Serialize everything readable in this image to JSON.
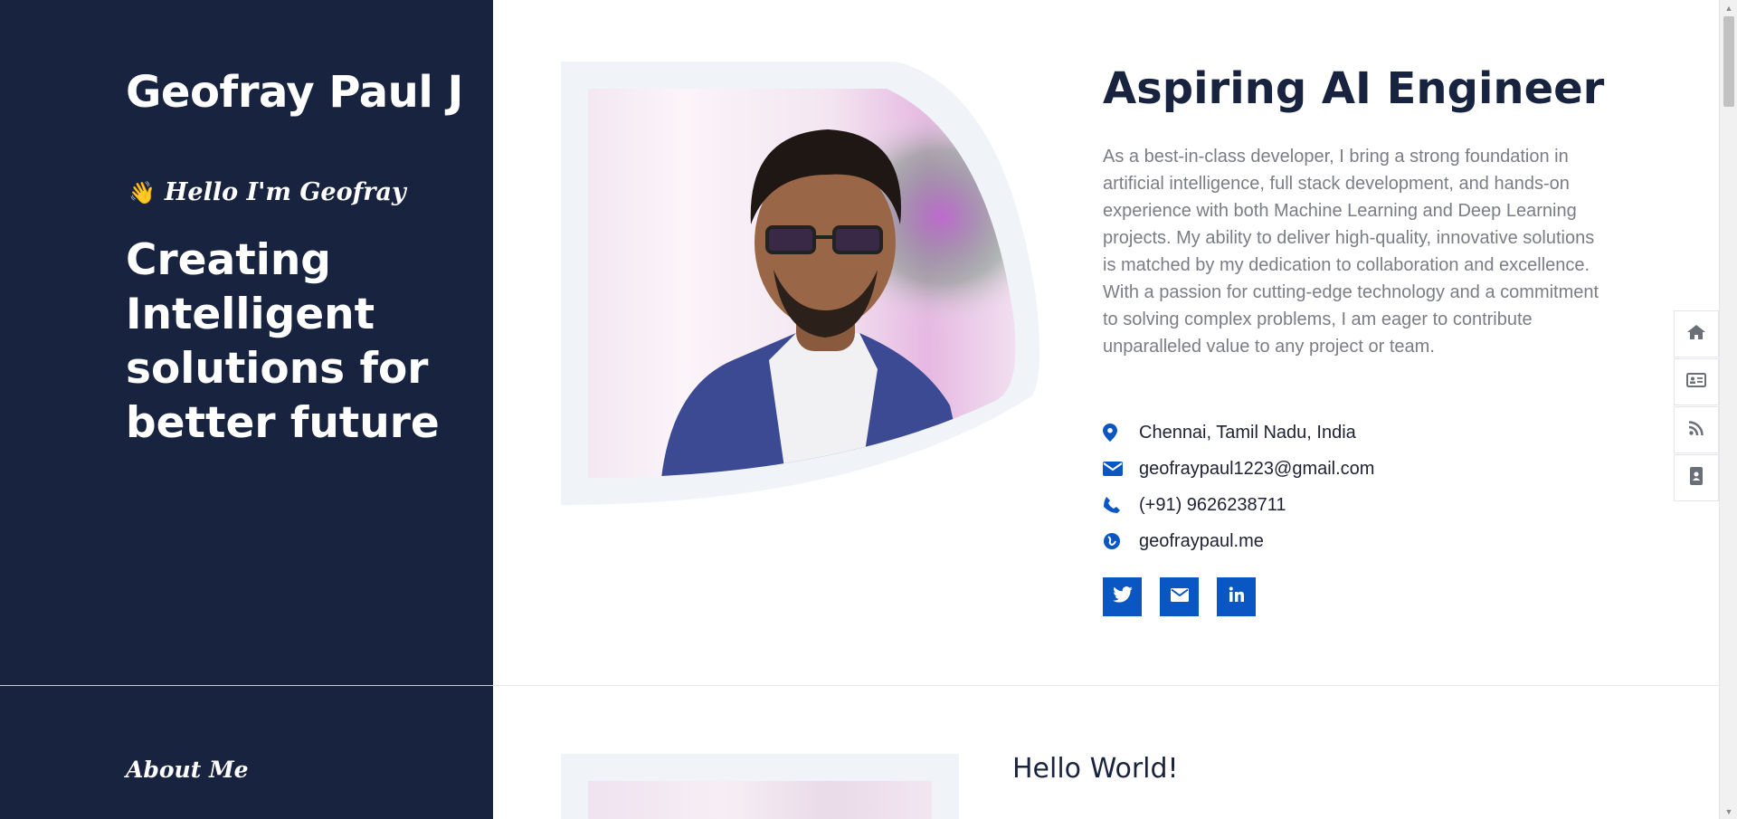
{
  "sidebar": {
    "name": "Geofray Paul J",
    "greeting_emoji": "👋",
    "greeting": "Hello I'm Geofray",
    "tagline": "Creating Intelligent solutions for better future",
    "about_heading": "About Me"
  },
  "hero": {
    "title": "Aspiring AI Engineer",
    "bio": "As a best-in-class developer, I bring a strong foundation in artificial intelligence, full stack development, and hands-on experience with both Machine Learning and Deep Learning projects. My ability to deliver high-quality, innovative solutions is matched by my dedication to collaboration and excellence. With a passion for cutting-edge technology and a commitment to solving complex problems, I am eager to contribute unparalleled value to any project or team."
  },
  "contacts": [
    {
      "icon": "map-marker-icon",
      "text": "Chennai, Tamil Nadu, India"
    },
    {
      "icon": "envelope-icon",
      "text": "geofraypaul1223@gmail.com"
    },
    {
      "icon": "phone-icon",
      "text": "(+91) 9626238711"
    },
    {
      "icon": "globe-icon",
      "text": "geofraypaul.me"
    }
  ],
  "socials": [
    {
      "icon": "twitter-icon"
    },
    {
      "icon": "envelope-icon"
    },
    {
      "icon": "linkedin-icon"
    }
  ],
  "side_nav": [
    {
      "icon": "home-icon"
    },
    {
      "icon": "id-card-icon"
    },
    {
      "icon": "rss-icon"
    },
    {
      "icon": "contact-book-icon"
    }
  ],
  "next_section": {
    "heading": "Hello World!"
  },
  "colors": {
    "sidebar_bg": "#18233f",
    "accent": "#0a56c2",
    "text_muted": "#7a7d84",
    "frame_bg": "#f0f3f8"
  }
}
